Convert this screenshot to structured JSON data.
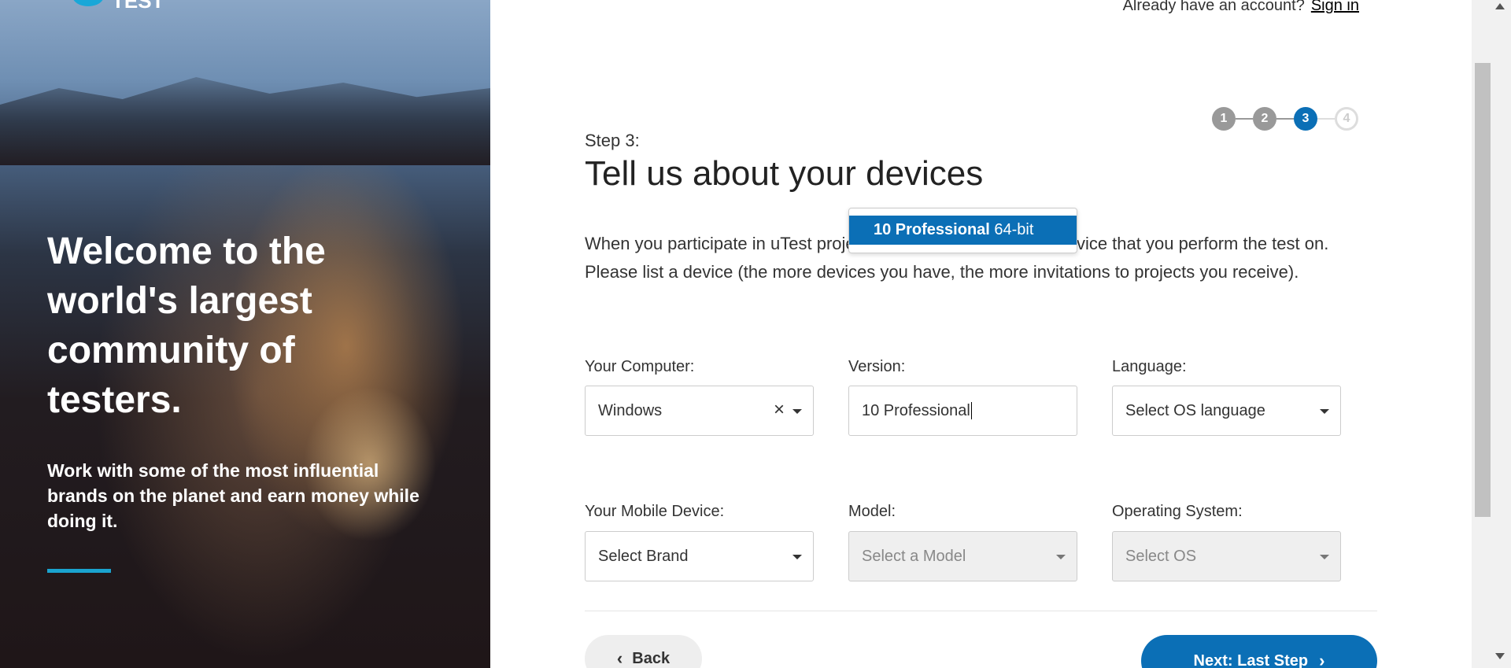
{
  "hero": {
    "logo_text": "TEST",
    "heading": "Welcome to the world's largest community of testers.",
    "subheading": "Work with some of the most influential brands on the planet and earn money while doing it."
  },
  "header": {
    "prompt": "Already have an account?",
    "signin_label": "Sign in"
  },
  "stepper": {
    "steps": [
      "1",
      "2",
      "3",
      "4"
    ],
    "current": 3
  },
  "main": {
    "step_label": "Step 3:",
    "title": "Tell us about your devices",
    "intro": "When you participate in uTest projects, you need at least one device that you perform the test on. Please list a device (the more devices you have, the more invitations to projects you receive)."
  },
  "autocomplete": {
    "match": "10 Professional",
    "rest": " 64-bit"
  },
  "computer": {
    "label": "Your Computer:",
    "value": "Windows",
    "clear_icon": "×"
  },
  "version": {
    "label": "Version:",
    "value": "10 Professional"
  },
  "language": {
    "label": "Language:",
    "placeholder": "Select OS language"
  },
  "mobile": {
    "label": "Your Mobile Device:",
    "placeholder": "Select Brand"
  },
  "model": {
    "label": "Model:",
    "placeholder": "Select a Model"
  },
  "os": {
    "label": "Operating System:",
    "placeholder": "Select OS"
  },
  "buttons": {
    "back": "Back",
    "next": "Next: Last Step"
  },
  "colors": {
    "primary": "#0b6fb6",
    "accent": "#1aa3cf"
  }
}
